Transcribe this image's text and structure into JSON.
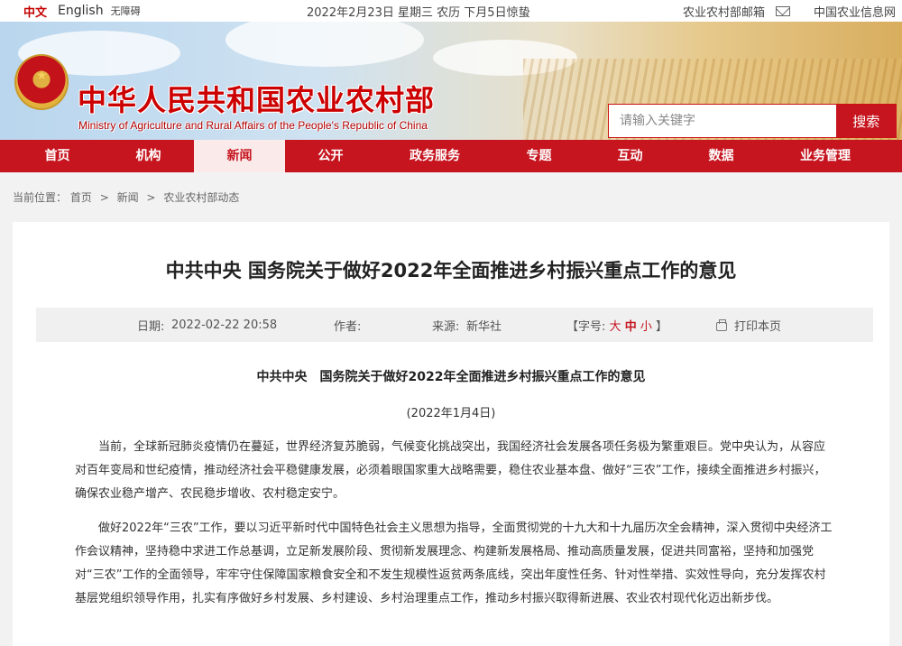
{
  "topbar": {
    "lang_cn": "中文",
    "lang_en": "English",
    "accessibility": "无障碍",
    "date": "2022年2月23日 星期三 农历 下月5日惊蛰",
    "mailbox": "农业农村部邮箱",
    "info_net": "中国农业信息网"
  },
  "header": {
    "title": "中华人民共和国农业农村部",
    "subtitle": "Ministry of Agriculture and Rural Affairs of the People's Republic of China"
  },
  "search": {
    "placeholder": "请输入关键字",
    "button": "搜索"
  },
  "nav": {
    "items": [
      "首页",
      "机构",
      "新闻",
      "公开",
      "政务服务",
      "专题",
      "互动",
      "数据",
      "业务管理"
    ],
    "active": "新闻"
  },
  "breadcrumb": {
    "label": "当前位置：",
    "items": [
      "首页",
      "新闻",
      "农业农村部动态"
    ],
    "sep": ">"
  },
  "article": {
    "title": "中共中央 国务院关于做好2022年全面推进乡村振兴重点工作的意见",
    "meta": {
      "date_label": "日期:",
      "date_value": "2022-02-22 20:58",
      "author_label": "作者:",
      "source_label": "来源:",
      "source_value": "新华社",
      "fontsize_label": "【字号:",
      "size_big": "大",
      "size_mid": "中",
      "size_small": "小",
      "fontsize_end": "】",
      "print": "打印本页"
    },
    "doc_title": "中共中央　国务院关于做好2022年全面推进乡村振兴重点工作的意见",
    "doc_date": "(2022年1月4日)",
    "paragraphs": [
      "当前，全球新冠肺炎疫情仍在蔓延，世界经济复苏脆弱，气候变化挑战突出，我国经济社会发展各项任务极为繁重艰巨。党中央认为，从容应对百年变局和世纪疫情，推动经济社会平稳健康发展，必须着眼国家重大战略需要，稳住农业基本盘、做好“三农”工作，接续全面推进乡村振兴，确保农业稳产增产、农民稳步增收、农村稳定安宁。",
      "做好2022年“三农”工作，要以习近平新时代中国特色社会主义思想为指导，全面贯彻党的十九大和十九届历次全会精神，深入贯彻中央经济工作会议精神，坚持稳中求进工作总基调，立足新发展阶段、贯彻新发展理念、构建新发展格局、推动高质量发展，促进共同富裕，坚持和加强党对“三农”工作的全面领导，牢牢守住保障国家粮食安全和不发生规模性返贫两条底线，突出年度性任务、针对性举措、实效性导向，充分发挥农村基层党组织领导作用，扎实有序做好乡村发展、乡村建设、乡村治理重点工作，推动乡村振兴取得新进展、农业农村现代化迈出新步伐。"
    ]
  }
}
